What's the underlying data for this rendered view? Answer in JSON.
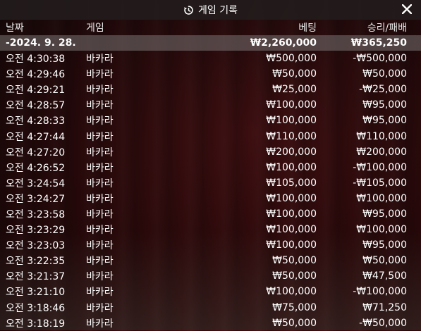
{
  "window": {
    "title": "게임 기록",
    "title_icon": "history-icon",
    "close_icon": "close-icon"
  },
  "columns": {
    "date": "날짜",
    "game": "게임",
    "bet": "베팅",
    "result": "승리/패배"
  },
  "summary": {
    "date": "-2024. 9. 28.",
    "bet": "₩2,260,000",
    "result": "₩365,250"
  },
  "rows": [
    {
      "time": "오전 4:30:38",
      "game": "바카라",
      "bet": "₩500,000",
      "result": "-₩500,000"
    },
    {
      "time": "오전 4:29:46",
      "game": "바카라",
      "bet": "₩50,000",
      "result": "₩50,000"
    },
    {
      "time": "오전 4:29:21",
      "game": "바카라",
      "bet": "₩25,000",
      "result": "-₩25,000"
    },
    {
      "time": "오전 4:28:57",
      "game": "바카라",
      "bet": "₩100,000",
      "result": "₩95,000"
    },
    {
      "time": "오전 4:28:33",
      "game": "바카라",
      "bet": "₩100,000",
      "result": "₩95,000"
    },
    {
      "time": "오전 4:27:44",
      "game": "바카라",
      "bet": "₩110,000",
      "result": "₩110,000"
    },
    {
      "time": "오전 4:27:20",
      "game": "바카라",
      "bet": "₩200,000",
      "result": "₩200,000"
    },
    {
      "time": "오전 4:26:52",
      "game": "바카라",
      "bet": "₩100,000",
      "result": "-₩100,000"
    },
    {
      "time": "오전 3:24:54",
      "game": "바카라",
      "bet": "₩105,000",
      "result": "-₩105,000"
    },
    {
      "time": "오전 3:24:27",
      "game": "바카라",
      "bet": "₩100,000",
      "result": "₩100,000"
    },
    {
      "time": "오전 3:23:58",
      "game": "바카라",
      "bet": "₩100,000",
      "result": "₩95,000"
    },
    {
      "time": "오전 3:23:29",
      "game": "바카라",
      "bet": "₩100,000",
      "result": "₩100,000"
    },
    {
      "time": "오전 3:23:03",
      "game": "바카라",
      "bet": "₩100,000",
      "result": "₩95,000"
    },
    {
      "time": "오전 3:22:35",
      "game": "바카라",
      "bet": "₩50,000",
      "result": "₩50,000"
    },
    {
      "time": "오전 3:21:37",
      "game": "바카라",
      "bet": "₩50,000",
      "result": "₩47,500"
    },
    {
      "time": "오전 3:21:10",
      "game": "바카라",
      "bet": "₩100,000",
      "result": "-₩100,000"
    },
    {
      "time": "오전 3:18:46",
      "game": "바카라",
      "bet": "₩75,000",
      "result": "₩71,250"
    },
    {
      "time": "오전 3:18:19",
      "game": "바카라",
      "bet": "₩50,000",
      "result": "-₩50,000"
    }
  ]
}
